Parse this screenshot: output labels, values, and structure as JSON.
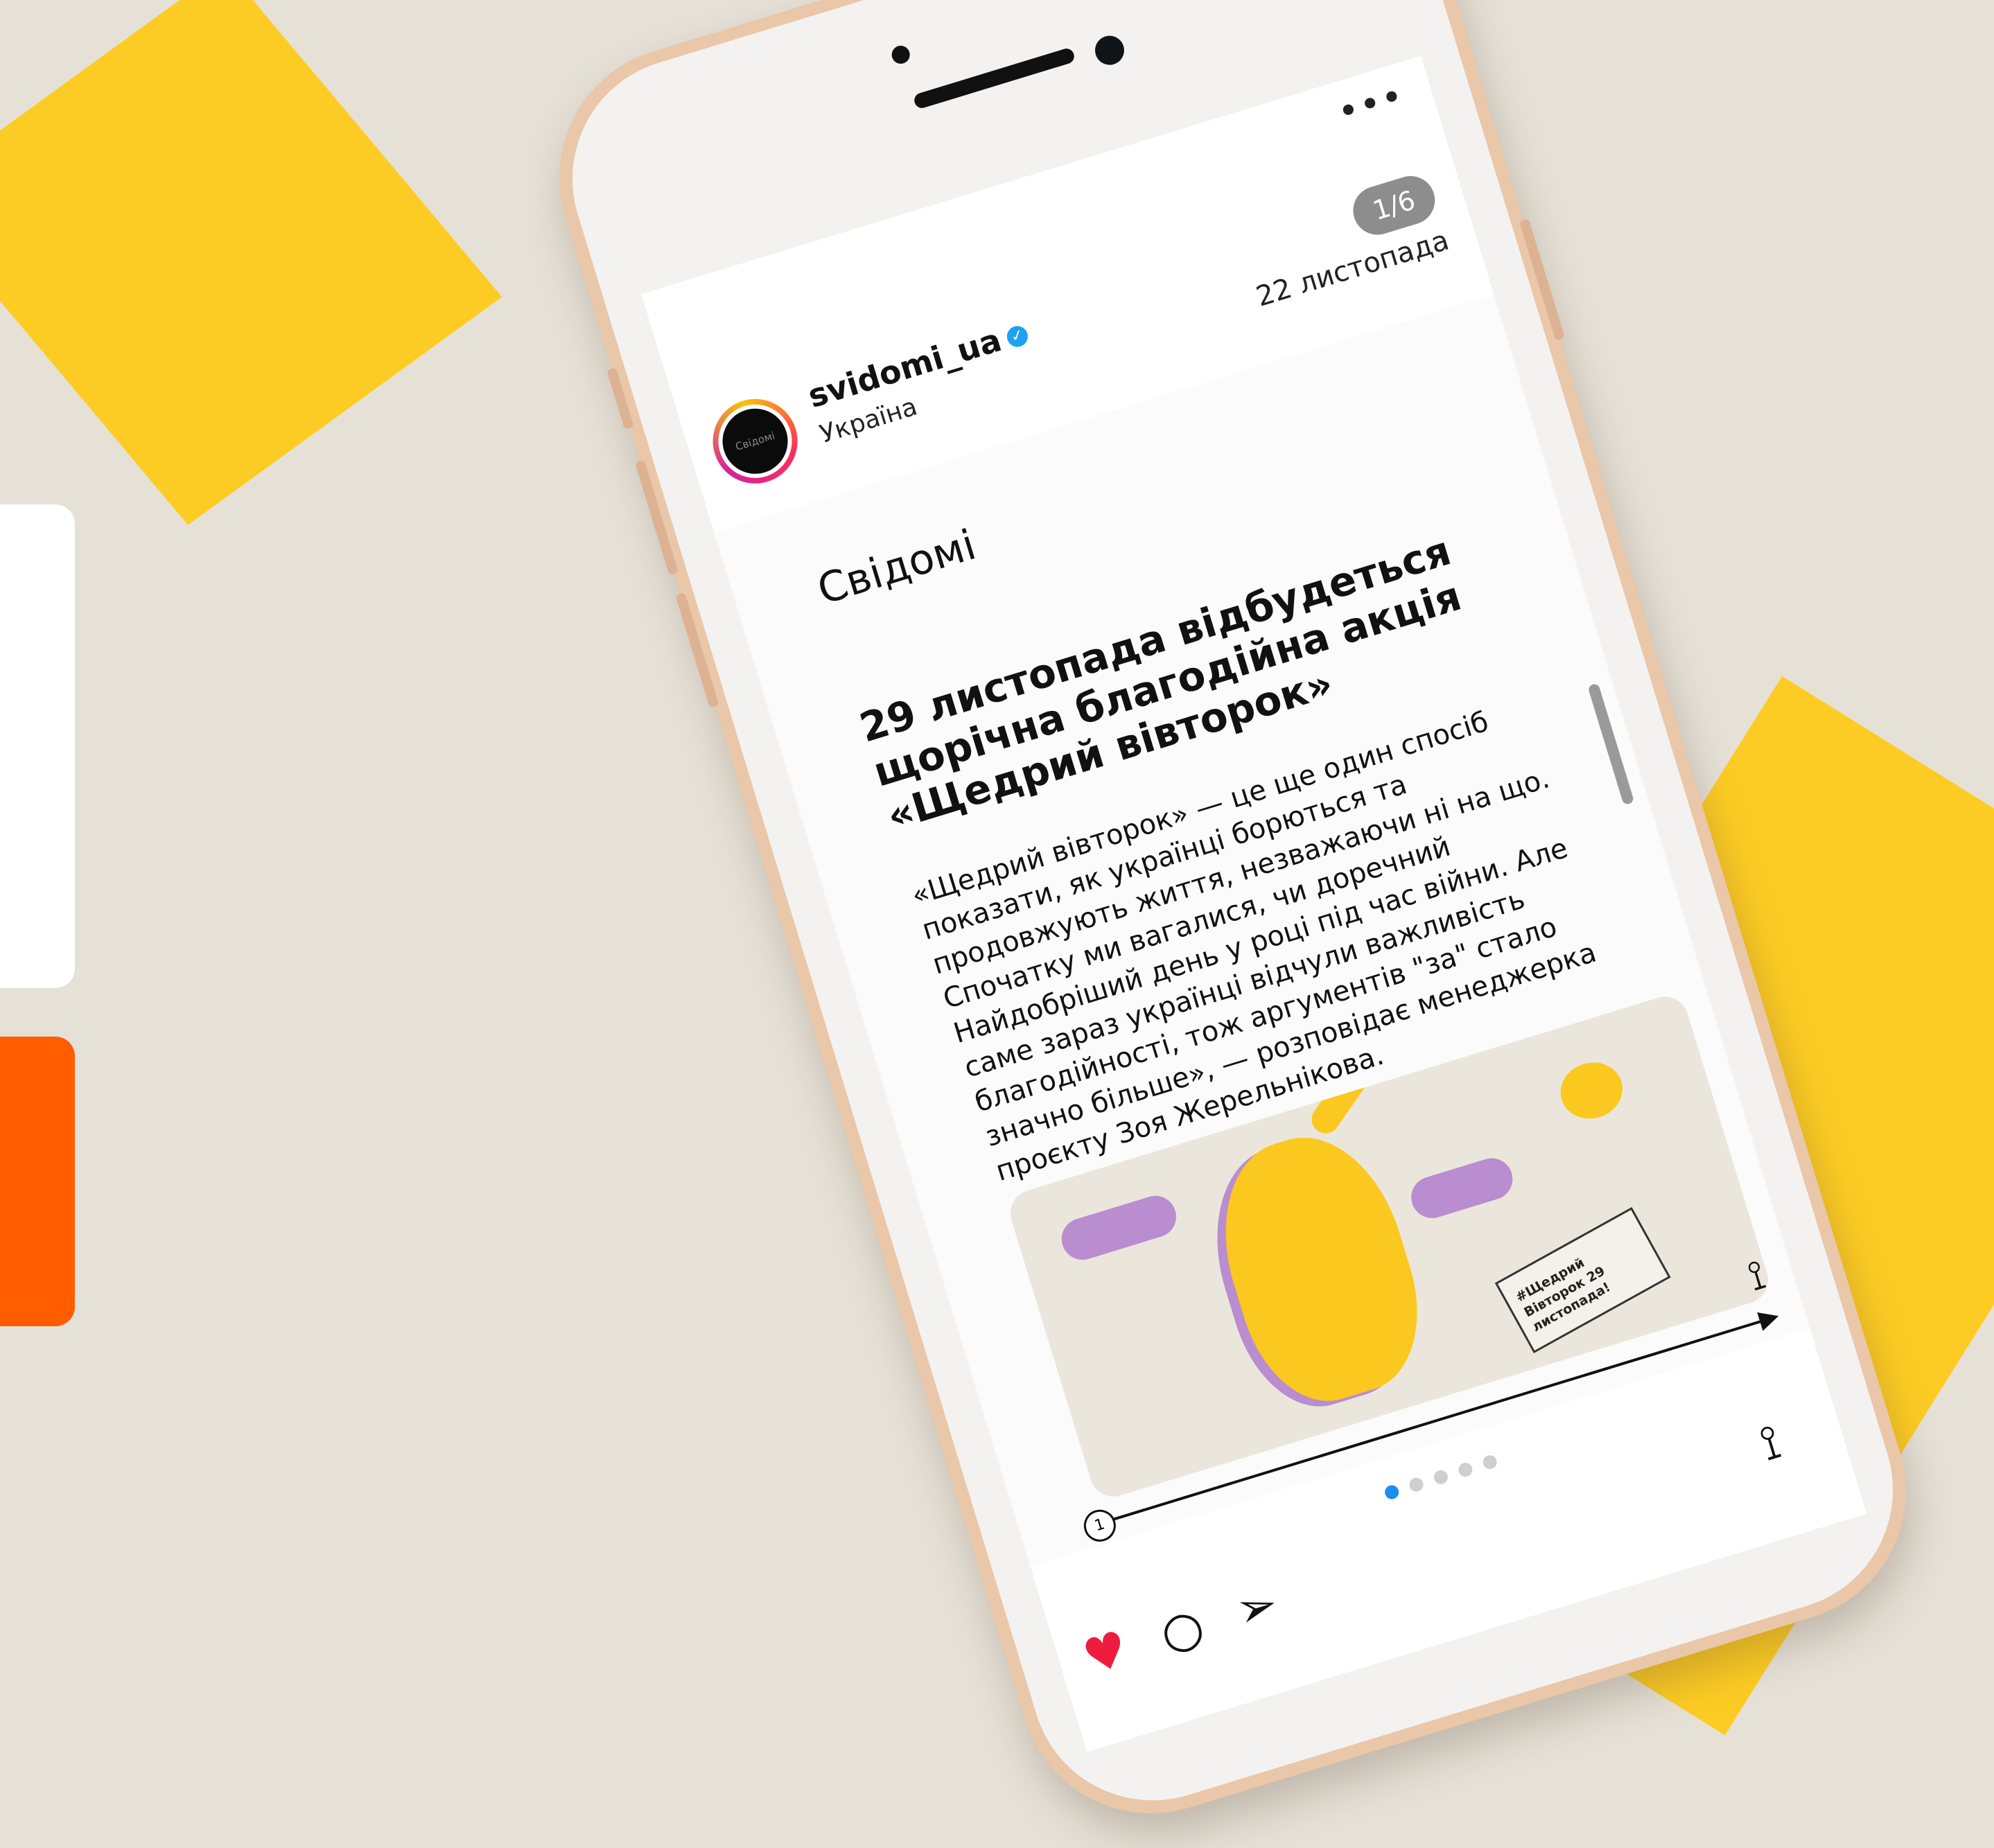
{
  "post": {
    "username": "svidomi_ua",
    "verified_icon": "verified-badge-icon",
    "location": "Україна",
    "date": "22 листопада",
    "counter": "1/6",
    "avatar_text": "Свідомі",
    "more_icon": "more-options-icon"
  },
  "slide": {
    "brand": "Свідомі",
    "headline": "29 листопада відбудеться щорічна благодійна акція «Щедрий вівторок»",
    "body": "«Щедрий вівторок» — це ще один спосіб показати, як українці борються та продовжують життя, незважаючи ні на що. Спочатку ми вагалися, чи доречний Найдобріший день у році під час війни. Але саме зараз українці відчули важливість благодійності, тож аргументів \"за\" стало значно більше», — розповідає менеджерка проєкту Зоя Жерельнікова.",
    "illustration_sign": "#Щедрий Вівторок 29 листопада!",
    "slide_number": "1"
  },
  "carousel": {
    "dots": 5,
    "active_index": 0
  },
  "actions": {
    "like_icon": "heart-icon",
    "comment_icon": "comment-icon",
    "share_icon": "paper-plane-icon",
    "save_icon": "bookmark-icon"
  },
  "colors": {
    "background": "#e6e1d7",
    "yellow": "#fdcc24",
    "orange": "#ff5d00",
    "like": "#ed1c3e",
    "active_dot": "#1b8ef0"
  }
}
